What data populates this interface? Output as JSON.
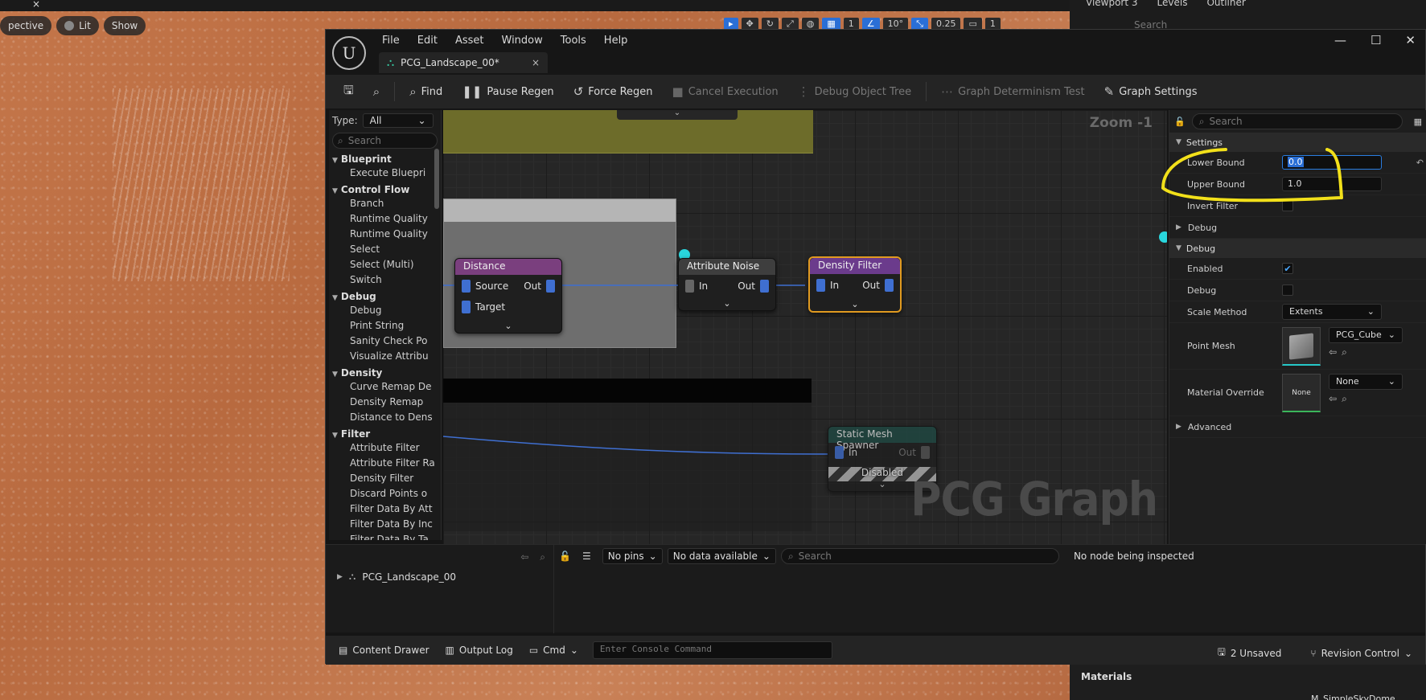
{
  "viewport": {
    "pills": [
      {
        "label": "pective",
        "icon": "perspective-icon"
      },
      {
        "label": "Lit",
        "icon": "lit-icon"
      },
      {
        "label": "Show",
        "icon": ""
      }
    ],
    "toolbar_values": [
      "1",
      "10°",
      "0.25",
      "1"
    ]
  },
  "level_tabs": [
    "Viewport 3",
    "Levels",
    "Outliner"
  ],
  "outliner_search_placeholder": "Search",
  "materials": {
    "title": "Materials",
    "value": "M_SimpleSkyDome"
  },
  "editor": {
    "menu": [
      "File",
      "Edit",
      "Asset",
      "Window",
      "Tools",
      "Help"
    ],
    "tab_title": "PCG_Landscape_00*",
    "toolbar": {
      "find": "Find",
      "pause_regen": "Pause Regen",
      "force_regen": "Force Regen",
      "cancel_execution": "Cancel Execution",
      "debug_object_tree": "Debug Object Tree",
      "graph_determinism_test": "Graph Determinism Test",
      "graph_settings": "Graph Settings"
    }
  },
  "palette": {
    "type_label": "Type:",
    "type_value": "All",
    "search_placeholder": "Search",
    "categories": [
      {
        "name": "Blueprint",
        "items": [
          "Execute Bluepri"
        ]
      },
      {
        "name": "Control Flow",
        "items": [
          "Branch",
          "Runtime Quality",
          "Runtime Quality",
          "Select",
          "Select (Multi)",
          "Switch"
        ]
      },
      {
        "name": "Debug",
        "items": [
          "Debug",
          "Print String",
          "Sanity Check Po",
          "Visualize Attribu"
        ]
      },
      {
        "name": "Density",
        "items": [
          "Curve Remap De",
          "Density Remap",
          "Distance to Dens"
        ]
      },
      {
        "name": "Filter",
        "items": [
          "Attribute Filter",
          "Attribute Filter Ra",
          "Density Filter",
          "Discard Points o",
          "Filter Data By Att",
          "Filter Data By Inc",
          "Filter Data By Ta"
        ]
      }
    ]
  },
  "graph": {
    "zoom": "Zoom -1",
    "watermark": "PCG Graph",
    "nodes": {
      "distance": {
        "title": "Distance",
        "pin_source": "Source",
        "pin_target": "Target",
        "pin_out": "Out",
        "color": "#7a3f7e"
      },
      "attribute_noise": {
        "title": "Attribute Noise",
        "pin_in": "In",
        "pin_out": "Out",
        "color": "#3e3e3e"
      },
      "density_filter": {
        "title": "Density Filter",
        "pin_in": "In",
        "pin_out": "Out",
        "color": "#6b3b8c"
      },
      "static_mesh_spawner": {
        "title": "Static Mesh Spawner",
        "pin_in": "In",
        "pin_out": "Out",
        "status": "Disabled",
        "color": "#1f4a44"
      }
    }
  },
  "details": {
    "search_placeholder": "Search",
    "sections": {
      "settings": "Settings",
      "debug_collapsed": "Debug",
      "debug": "Debug",
      "advanced": "Advanced"
    },
    "lower_bound": {
      "label": "Lower Bound",
      "value": "0.0"
    },
    "upper_bound": {
      "label": "Upper Bound",
      "value": "1.0"
    },
    "invert_filter": {
      "label": "Invert Filter",
      "checked": false
    },
    "enabled": {
      "label": "Enabled",
      "checked": true
    },
    "debug_flag": {
      "label": "Debug",
      "checked": false
    },
    "scale_method": {
      "label": "Scale Method",
      "value": "Extents"
    },
    "point_mesh": {
      "label": "Point Mesh",
      "value": "PCG_Cube"
    },
    "material_override": {
      "label": "Material Override",
      "value": "None",
      "thumb_label": "None"
    }
  },
  "bottom": {
    "tree_item": "PCG_Landscape_00",
    "pins_filter": "No pins",
    "data_filter": "No data available",
    "search_placeholder": "Search",
    "status": "No node being inspected"
  },
  "statusbar": {
    "content_drawer": "Content Drawer",
    "output_log": "Output Log",
    "cmd": "Cmd",
    "console_placeholder": "Enter Console Command",
    "unsaved": "2 Unsaved",
    "revision_control": "Revision Control"
  },
  "annotation_color": "#f2e01a"
}
